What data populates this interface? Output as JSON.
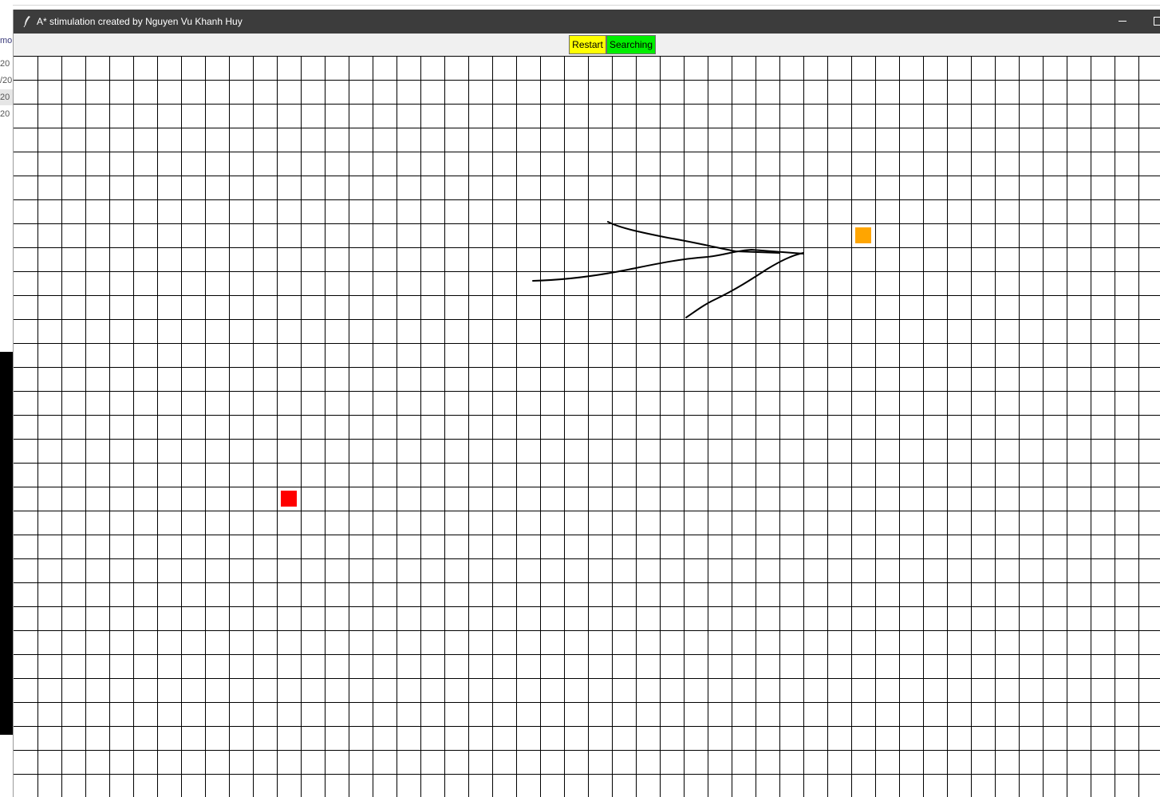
{
  "background_window": {
    "items": [
      "mo",
      "20",
      "/20",
      "20",
      "20"
    ]
  },
  "window": {
    "title": "A* stimulation created by Nguyen Vu Khanh Huy",
    "icon": "feather-icon",
    "controls": {
      "minimize_icon": "minimize-icon",
      "maximize_icon": "maximize-icon"
    }
  },
  "toolbar": {
    "restart_label": "Restart",
    "restart_color": "#ffff00",
    "status_label": "Searching",
    "status_color": "#00ee00"
  },
  "grid": {
    "columns": 48,
    "rows": 31,
    "start_cell": {
      "col": 11,
      "row": 18,
      "color": "#ff0000"
    },
    "end_cell": {
      "col": 35,
      "row": 7,
      "color": "#ffa500"
    },
    "line_color": "#000000",
    "background": "#ffffff"
  }
}
